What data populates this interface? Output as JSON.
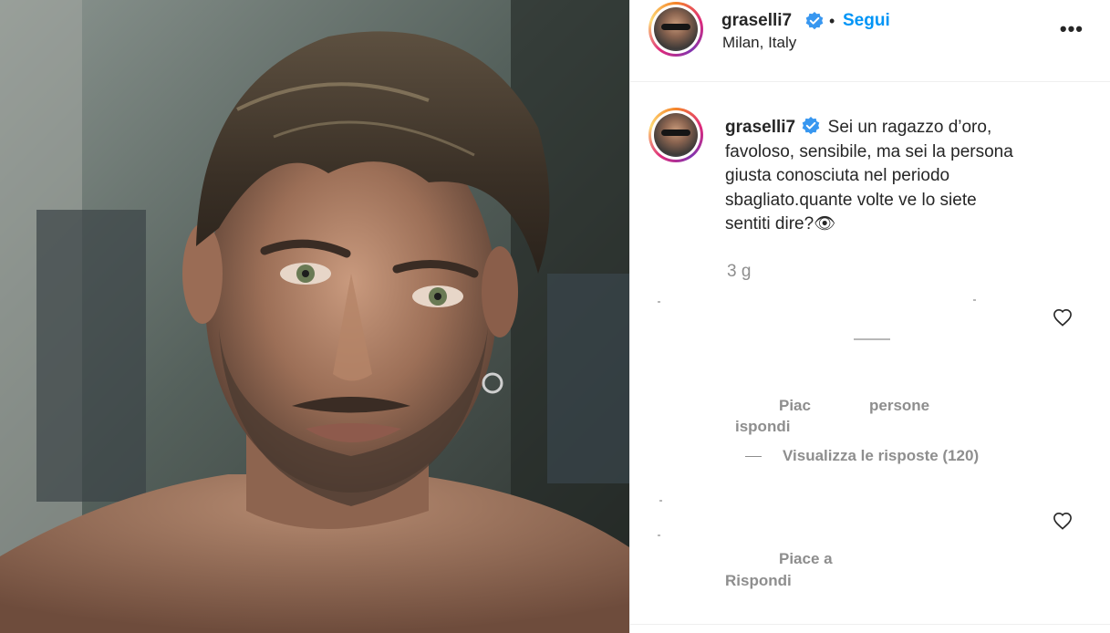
{
  "post": {
    "username": "graselli7",
    "separator": "•",
    "follow_label": "Segui",
    "location": "Milan, Italy",
    "more_label": "•••"
  },
  "caption": {
    "username": "graselli7",
    "lines": [
      "Sei un ragazzo d’oro,",
      "favoloso, sensibile, ma sei la persona",
      "giusta conosciuta nel periodo",
      "sbagliato.quante volte ve lo siete",
      "sentiti dire?👁"
    ],
    "time": "3 g"
  },
  "comments": [
    {
      "likes_text": "Piac",
      "likes_suffix": "persone",
      "reply_label": "ispondi",
      "view_replies_label": "Visualizza le risposte (120)"
    },
    {
      "likes_text": "Piace a",
      "reply_label": "Rispondi"
    }
  ],
  "colors": {
    "accent": "#0095f6",
    "verified": "#3897f0",
    "text": "#262626",
    "muted": "#8e8e8e"
  },
  "icons": {
    "verified": "verified-badge-icon",
    "heart": "heart-outline-icon",
    "more": "more-options-icon"
  }
}
